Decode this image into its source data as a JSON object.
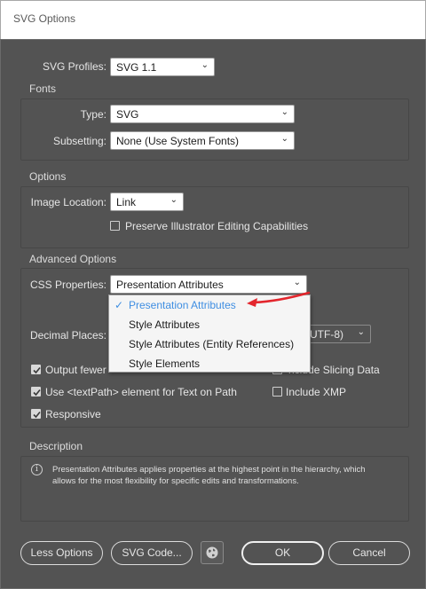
{
  "window": {
    "title": "SVG Options"
  },
  "svg_profiles": {
    "label": "SVG Profiles:",
    "value": "SVG 1.1"
  },
  "fonts": {
    "title": "Fonts",
    "type_label": "Type:",
    "type_value": "SVG",
    "subsetting_label": "Subsetting:",
    "subsetting_value": "None (Use System Fonts)"
  },
  "options": {
    "title": "Options",
    "image_location_label": "Image Location:",
    "image_location_value": "Link",
    "preserve_label": "Preserve Illustrator Editing Capabilities",
    "preserve_checked": false
  },
  "advanced": {
    "title": "Advanced Options",
    "css_label": "CSS Properties:",
    "css_value": "Presentation Attributes",
    "css_menu": [
      {
        "label": "Presentation Attributes",
        "selected": true
      },
      {
        "label": "Style Attributes",
        "selected": false
      },
      {
        "label": "Style Attributes (Entity References)",
        "selected": false
      },
      {
        "label": "Style Elements",
        "selected": false
      }
    ],
    "decimal_label": "Decimal Places:",
    "encoding_partial": "UTF-8)",
    "output_fewer_label": "Output fewer <tspan> elements",
    "output_fewer_visible": "Output fewer",
    "include_slicing_label": "Include Slicing Data",
    "include_slicing_visible": "nclude Slicing Data",
    "textpath_label": "Use <textPath> element for Text on Path",
    "include_xmp_label": "Include XMP",
    "responsive_label": "Responsive",
    "checks": {
      "output_fewer": true,
      "include_slicing": false,
      "textpath": true,
      "include_xmp": false,
      "responsive": true
    }
  },
  "description": {
    "title": "Description",
    "line1": "Presentation Attributes applies properties at the highest point in the hierarchy, which",
    "line2": "allows for the most flexibility for specific edits and transformations."
  },
  "buttons": {
    "less_options": "Less Options",
    "svg_code": "SVG Code...",
    "ok": "OK",
    "cancel": "Cancel"
  },
  "icons": {
    "dropdown": "chevron-down-icon",
    "check": "checkmark-icon",
    "info": "info-icon",
    "web": "globe-icon",
    "annotation": "red-arrow-annotation"
  },
  "colors": {
    "dialog_bg": "#535353",
    "accent_selected": "#3f8ee2",
    "annotation_arrow": "#e3262d",
    "menu_bg": "#f5f5f5"
  }
}
